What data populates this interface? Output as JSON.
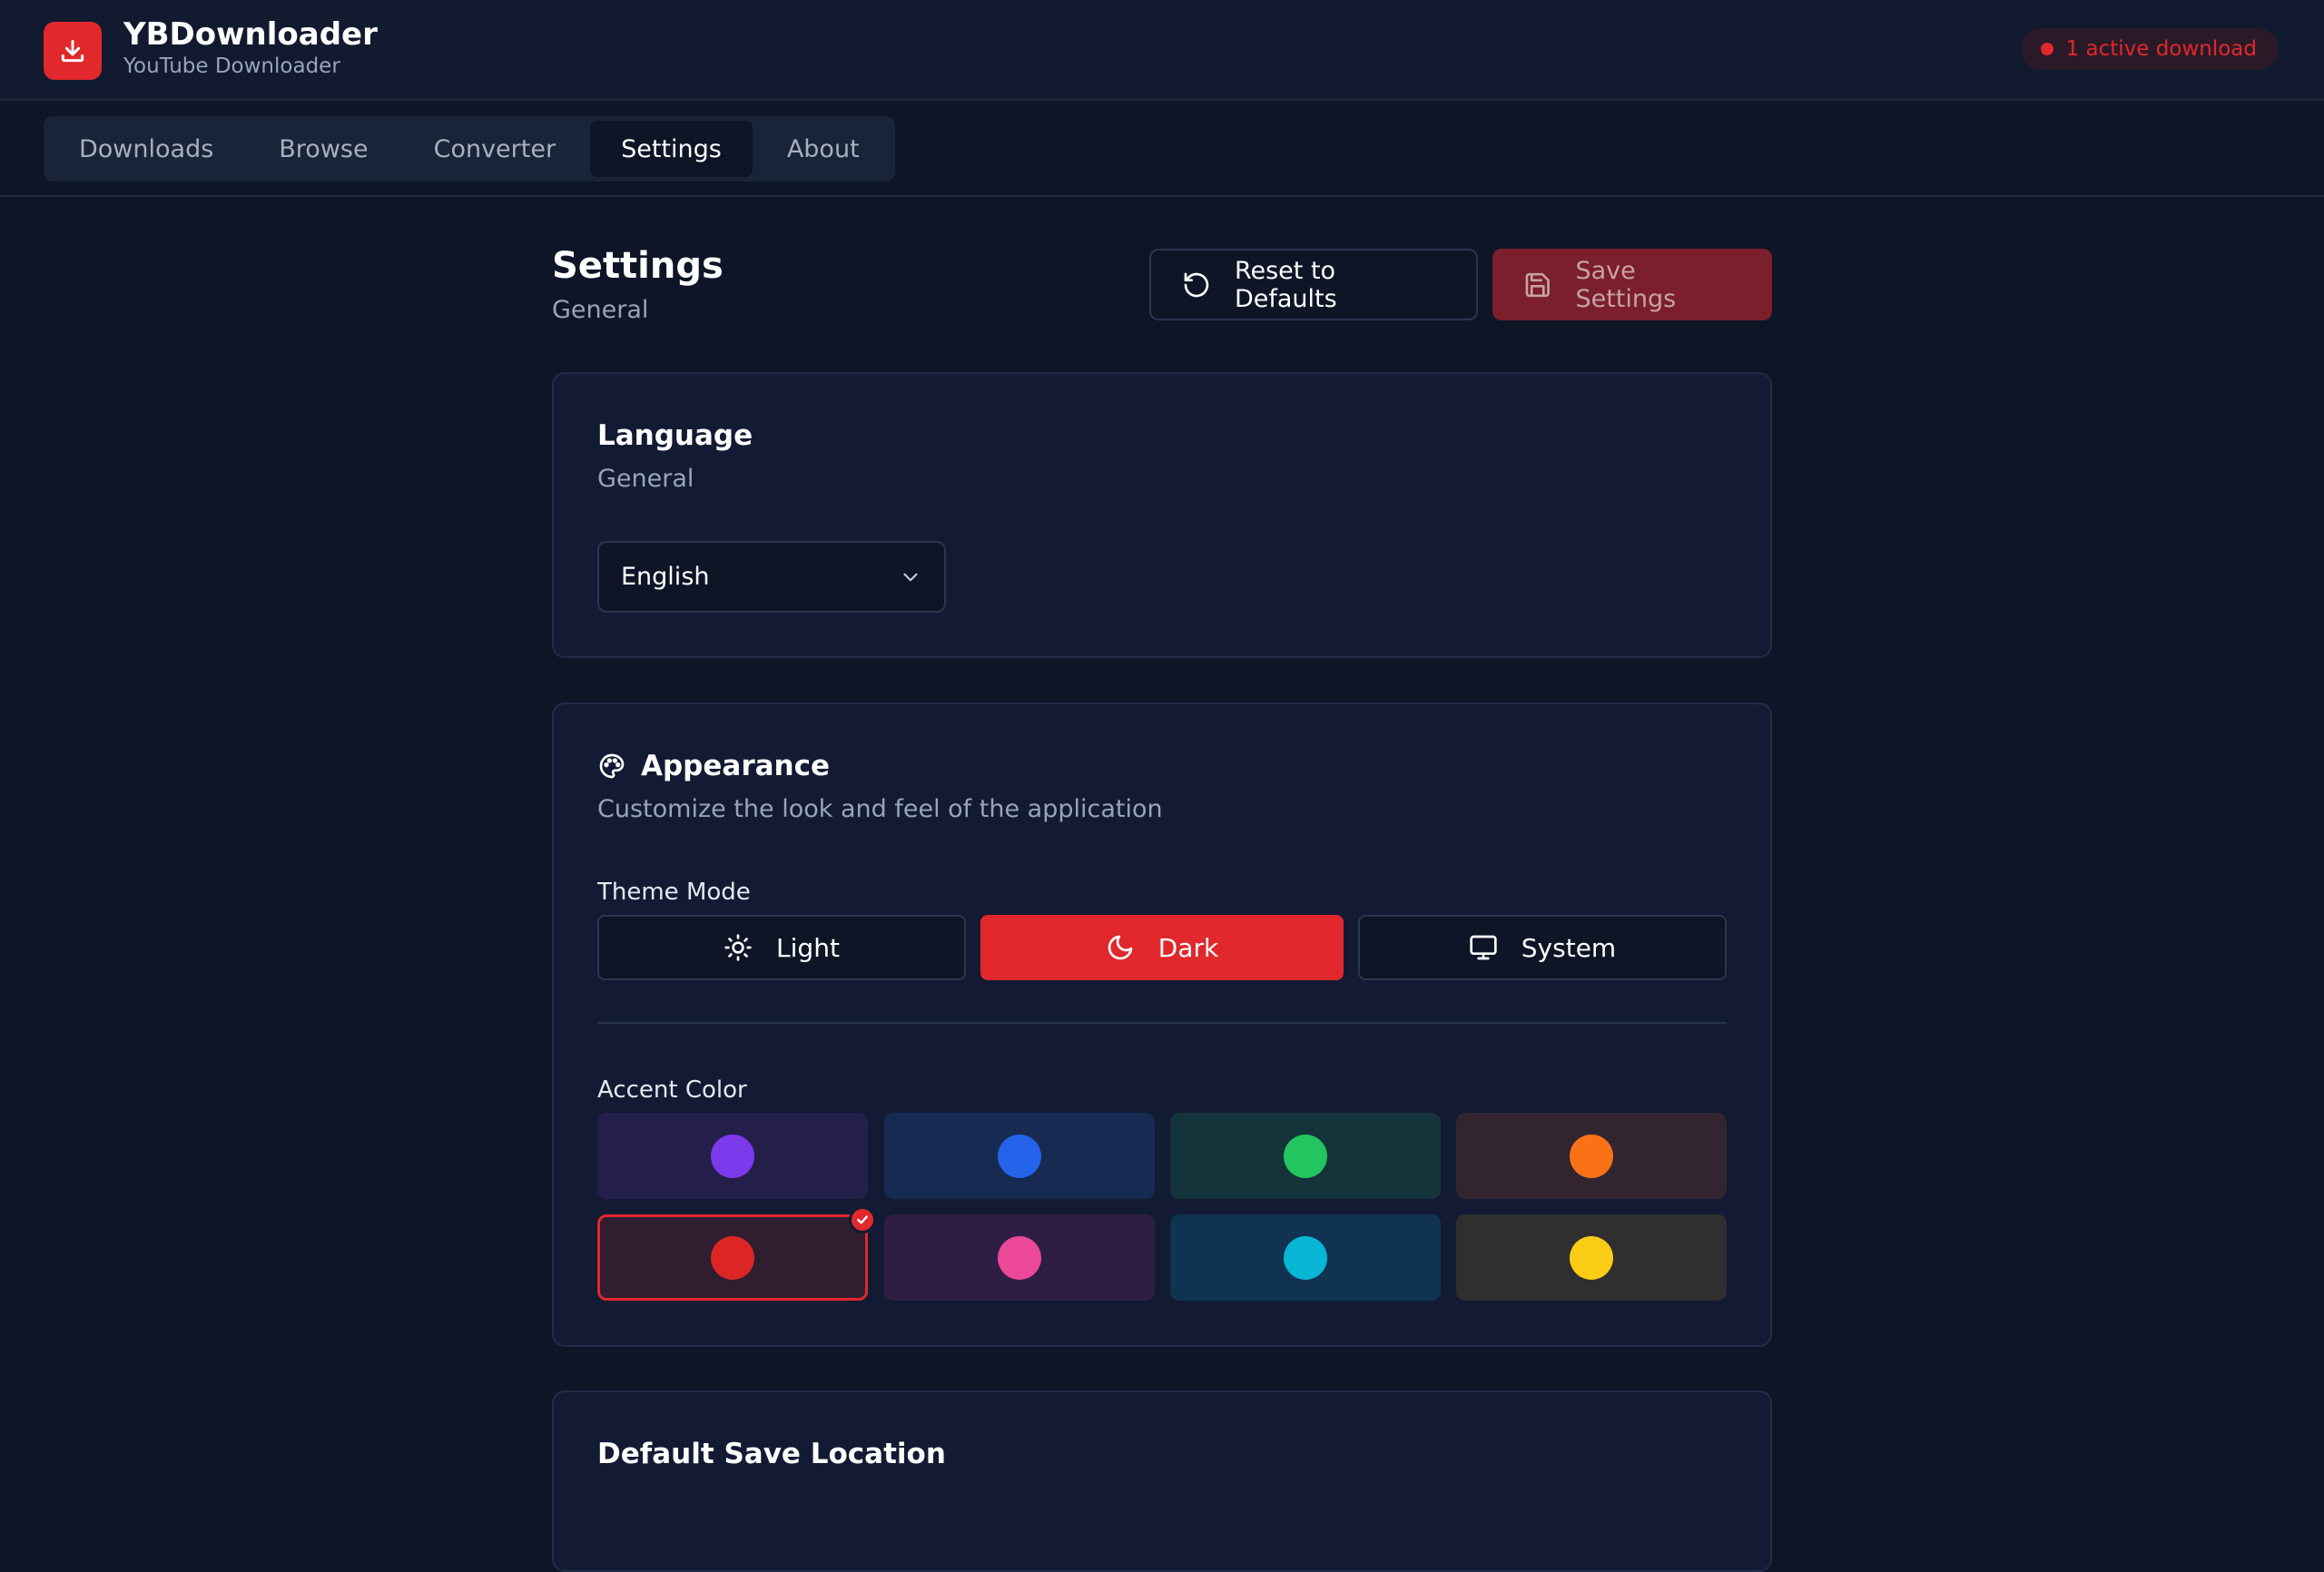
{
  "app": {
    "title": "YBDownloader",
    "subtitle": "YouTube Downloader",
    "active_downloads": "1 active download",
    "accent": "#e0282d"
  },
  "nav": {
    "tabs": [
      {
        "label": "Downloads",
        "active": false
      },
      {
        "label": "Browse",
        "active": false
      },
      {
        "label": "Converter",
        "active": false
      },
      {
        "label": "Settings",
        "active": true
      },
      {
        "label": "About",
        "active": false
      }
    ]
  },
  "page": {
    "title": "Settings",
    "subtitle": "General",
    "reset_label": "Reset to Defaults",
    "save_label": "Save Settings"
  },
  "language": {
    "title": "Language",
    "description": "General",
    "selected": "English"
  },
  "appearance": {
    "title": "Appearance",
    "description": "Customize the look and feel of the application",
    "theme_label": "Theme Mode",
    "themes": [
      {
        "label": "Light",
        "icon": "sun-icon",
        "active": false
      },
      {
        "label": "Dark",
        "icon": "moon-icon",
        "active": true
      },
      {
        "label": "System",
        "icon": "monitor-icon",
        "active": false
      }
    ],
    "accent_label": "Accent Color",
    "accent_colors": [
      {
        "name": "purple",
        "color": "#7c3aed",
        "bg": "#241f4a",
        "selected": false
      },
      {
        "name": "blue",
        "color": "#2563eb",
        "bg": "#162a52",
        "selected": false
      },
      {
        "name": "green",
        "color": "#22c55e",
        "bg": "#15333a",
        "selected": false
      },
      {
        "name": "orange",
        "color": "#f97316",
        "bg": "#332530",
        "selected": false
      },
      {
        "name": "red",
        "color": "#dc2626",
        "bg": "#301d30",
        "selected": true
      },
      {
        "name": "pink",
        "color": "#ec4899",
        "bg": "#2f1e44",
        "selected": false
      },
      {
        "name": "cyan",
        "color": "#06b6d4",
        "bg": "#0f3350",
        "selected": false
      },
      {
        "name": "yellow",
        "color": "#facc15",
        "bg": "#2f2f30",
        "selected": false
      }
    ]
  },
  "save_location": {
    "title": "Default Save Location"
  }
}
